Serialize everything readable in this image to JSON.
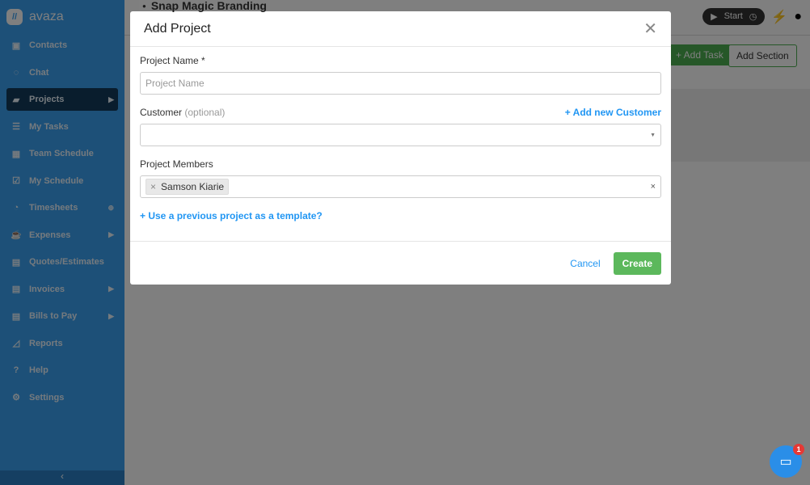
{
  "app": {
    "logo": "avaza"
  },
  "sidebar": {
    "items": [
      {
        "label": "Contacts",
        "icon": "contacts-icon",
        "glyph": "▣"
      },
      {
        "label": "Chat",
        "icon": "chat-icon",
        "glyph": "◌"
      },
      {
        "label": "Projects",
        "icon": "folder-icon",
        "glyph": "▰",
        "active": true,
        "tail": "▶"
      },
      {
        "label": "My Tasks",
        "icon": "tasks-icon",
        "glyph": "☰"
      },
      {
        "label": "Team Schedule",
        "icon": "calendar-icon",
        "glyph": "▦"
      },
      {
        "label": "My Schedule",
        "icon": "calendar-check-icon",
        "glyph": "☑"
      },
      {
        "label": "Timesheets",
        "icon": "stopwatch-icon",
        "glyph": "◔",
        "tail": "⊕"
      },
      {
        "label": "Expenses",
        "icon": "cup-icon",
        "glyph": "☕",
        "tail": "▶"
      },
      {
        "label": "Quotes/Estimates",
        "icon": "document-icon",
        "glyph": "▤"
      },
      {
        "label": "Invoices",
        "icon": "invoice-icon",
        "glyph": "▤",
        "tail": "▶"
      },
      {
        "label": "Bills to Pay",
        "icon": "bill-icon",
        "glyph": "▤",
        "tail": "▶"
      },
      {
        "label": "Reports",
        "icon": "chart-icon",
        "glyph": "◿"
      },
      {
        "label": "Help",
        "icon": "help-icon",
        "glyph": "?"
      },
      {
        "label": "Settings",
        "icon": "gear-icon",
        "glyph": "⚙"
      }
    ]
  },
  "header": {
    "project_title": "Snap Magic Branding",
    "start": "Start"
  },
  "toolbar": {
    "add_task": "+ Add Task",
    "add_section": "Add Section"
  },
  "modal": {
    "title": "Add Project",
    "project_name_label": "Project Name *",
    "project_name_placeholder": "Project Name",
    "customer_label": "Customer",
    "customer_optional": "(optional)",
    "add_customer": "+ Add new Customer",
    "members_label": "Project Members",
    "member": "Samson Kiarie",
    "template_link": "+ Use a previous project as a template?",
    "cancel": "Cancel",
    "create": "Create"
  },
  "chat_widget": {
    "badge": "1"
  }
}
